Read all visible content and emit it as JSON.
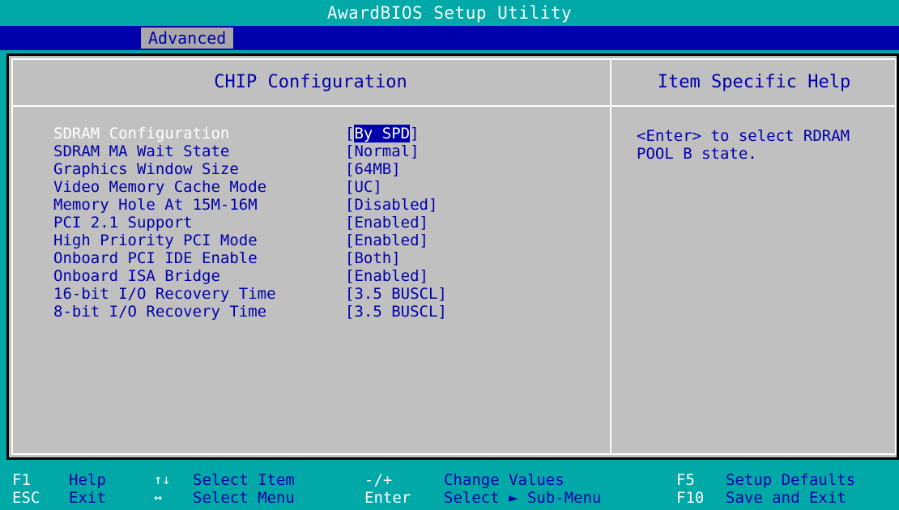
{
  "window": {
    "title": "AwardBIOS Setup Utility"
  },
  "menu": {
    "active_tab": "Advanced"
  },
  "main": {
    "title": "CHIP Configuration",
    "settings": [
      {
        "label": "SDRAM Configuration",
        "value": "By SPD",
        "selected": true
      },
      {
        "label": "SDRAM MA Wait State",
        "value": "Normal"
      },
      {
        "label": "Graphics Window Size",
        "value": "64MB"
      },
      {
        "label": "Video Memory Cache Mode",
        "value": "UC"
      },
      {
        "label": "Memory Hole At 15M-16M",
        "value": "Disabled"
      },
      {
        "label": "PCI 2.1 Support",
        "value": "Enabled"
      },
      {
        "label": "High Priority PCI Mode",
        "value": "Enabled"
      },
      {
        "label": "Onboard PCI IDE Enable",
        "value": "Both"
      },
      {
        "label": "Onboard ISA Bridge",
        "value": "Enabled"
      },
      {
        "label": "16-bit I/O Recovery Time",
        "value": "3.5 BUSCL"
      },
      {
        "label": "8-bit I/O Recovery Time",
        "value": "3.5 BUSCL"
      }
    ]
  },
  "help": {
    "title": "Item Specific Help",
    "text": "<Enter> to select RDRAM\nPOOL B state."
  },
  "footer": {
    "row1": {
      "key1": "F1",
      "desc1": "Help",
      "key2": "↑↓",
      "desc2": "Select Item",
      "key3": "-/+",
      "desc3": "Change Values",
      "key4": "F5",
      "desc4": "Setup Defaults"
    },
    "row2": {
      "key1": "ESC",
      "desc1": "Exit",
      "key2": "↔",
      "desc2": "Select Menu",
      "key3": "Enter",
      "desc3": "Select ► Sub-Menu",
      "key4": "F10",
      "desc4": "Save and Exit"
    }
  },
  "colors": {
    "background": "#00a8a8",
    "menu_bar": "#0000aa",
    "panel": "#c0c0c0",
    "text_primary": "#0000aa",
    "text_highlight": "#ffffff"
  }
}
